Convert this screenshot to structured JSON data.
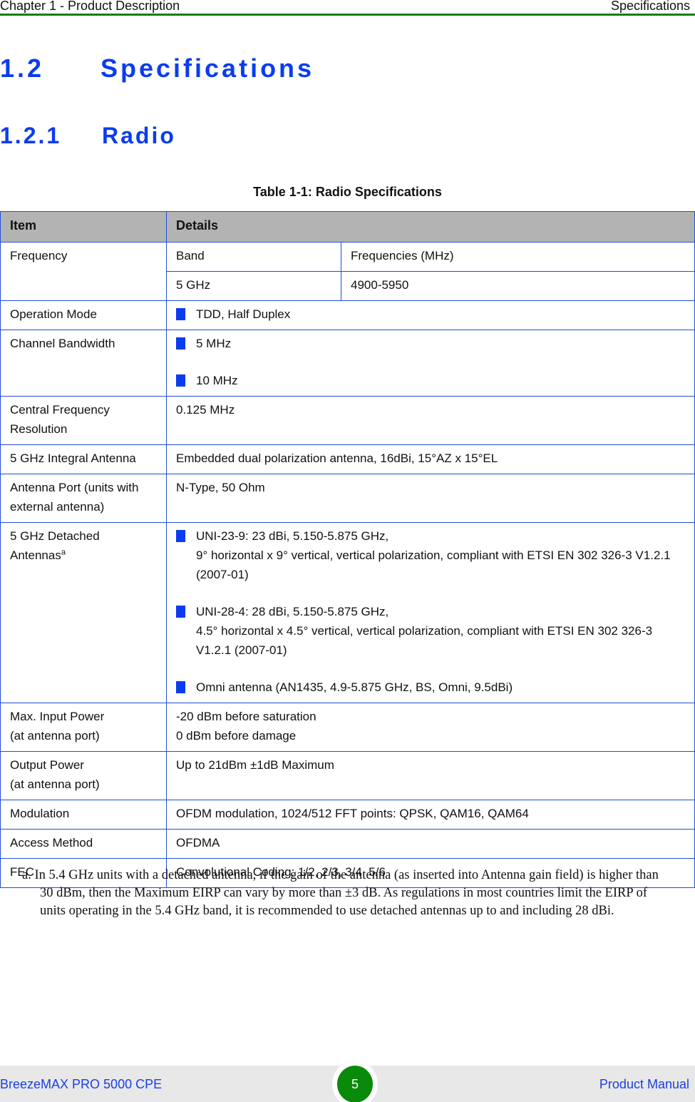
{
  "header": {
    "chapter": "Chapter 1 - Product Description",
    "section": "Specifications"
  },
  "headings": {
    "h1_number": "1.2",
    "h1_title": "Specifications",
    "h2_number": "1.2.1",
    "h2_title": "Radio"
  },
  "table": {
    "caption": "Table 1-1: Radio Specifications",
    "columns": [
      "Item",
      "Details"
    ],
    "frequency": {
      "item": "Frequency",
      "sub_headers": [
        "Band",
        "Frequencies (MHz)"
      ],
      "rows": [
        [
          "5 GHz",
          "4900-5950"
        ]
      ]
    },
    "rows": [
      {
        "item": "Operation Mode",
        "bullets": [
          "TDD, Half Duplex"
        ]
      },
      {
        "item": "Channel Bandwidth",
        "bullets": [
          "5 MHz",
          "10 MHz"
        ]
      },
      {
        "item": "Central Frequency Resolution",
        "lines": [
          "0.125 MHz"
        ]
      },
      {
        "item": "5 GHz Integral Antenna",
        "lines": [
          "Embedded dual polarization antenna, 16dBi, 15°AZ x 15°EL"
        ]
      },
      {
        "item": "Antenna Port (units with external antenna)",
        "lines": [
          "N-Type, 50 Ohm"
        ]
      },
      {
        "item": "5 GHz Detached Antennas",
        "item_footnote_mark": "a",
        "bullets_multi": [
          [
            "UNI-23-9: 23 dBi, 5.150-5.875 GHz,",
            "9° horizontal x 9° vertical, vertical polarization, compliant with ETSI EN 302 326-3 V1.2.1 (2007-01)"
          ],
          [
            "UNI-28-4: 28 dBi, 5.150-5.875 GHz,",
            "4.5° horizontal x 4.5° vertical, vertical polarization, compliant with ETSI EN 302 326-3 V1.2.1 (2007-01)"
          ],
          [
            "Omni antenna (AN1435, 4.9-5.875 GHz, BS, Omni, 9.5dBi)"
          ]
        ]
      },
      {
        "item_lines": [
          "Max. Input Power",
          "(at antenna port)"
        ],
        "lines": [
          "-20 dBm before saturation",
          "0 dBm before damage"
        ]
      },
      {
        "item_lines": [
          "Output Power",
          "(at antenna port)"
        ],
        "lines": [
          "Up to 21dBm ±1dB Maximum"
        ]
      },
      {
        "item": "Modulation",
        "lines": [
          "OFDM modulation, 1024/512 FFT points: QPSK, QAM16, QAM64"
        ]
      },
      {
        "item": "Access Method",
        "lines": [
          "OFDMA"
        ]
      },
      {
        "item": "FEC",
        "lines": [
          "Convolutional Coding: 1/2, 2/3, 3/4, 5/6"
        ]
      }
    ]
  },
  "footnote": {
    "mark": "a.",
    "text": "In 5.4 GHz units with a detached antenna, if the gain of the antenna (as inserted into Antenna gain field) is higher than 30 dBm, then the Maximum EIRP can vary by more than ±3 dB. As regulations in most countries limit the EIRP of units operating in the 5.4 GHz band, it is recommended to use detached antennas up to and including 28 dBi."
  },
  "footer": {
    "product": "BreezeMAX PRO 5000 CPE",
    "page_number": "5",
    "doc_type": "Product Manual"
  },
  "colors": {
    "heading_blue": "#0a3cf0",
    "rule_green": "#0a7f0a",
    "table_border": "#1f4fd6",
    "header_fill": "#b3b3b3",
    "footer_fill": "#e8e8e8",
    "page_badge_green": "#0a8a0a"
  }
}
